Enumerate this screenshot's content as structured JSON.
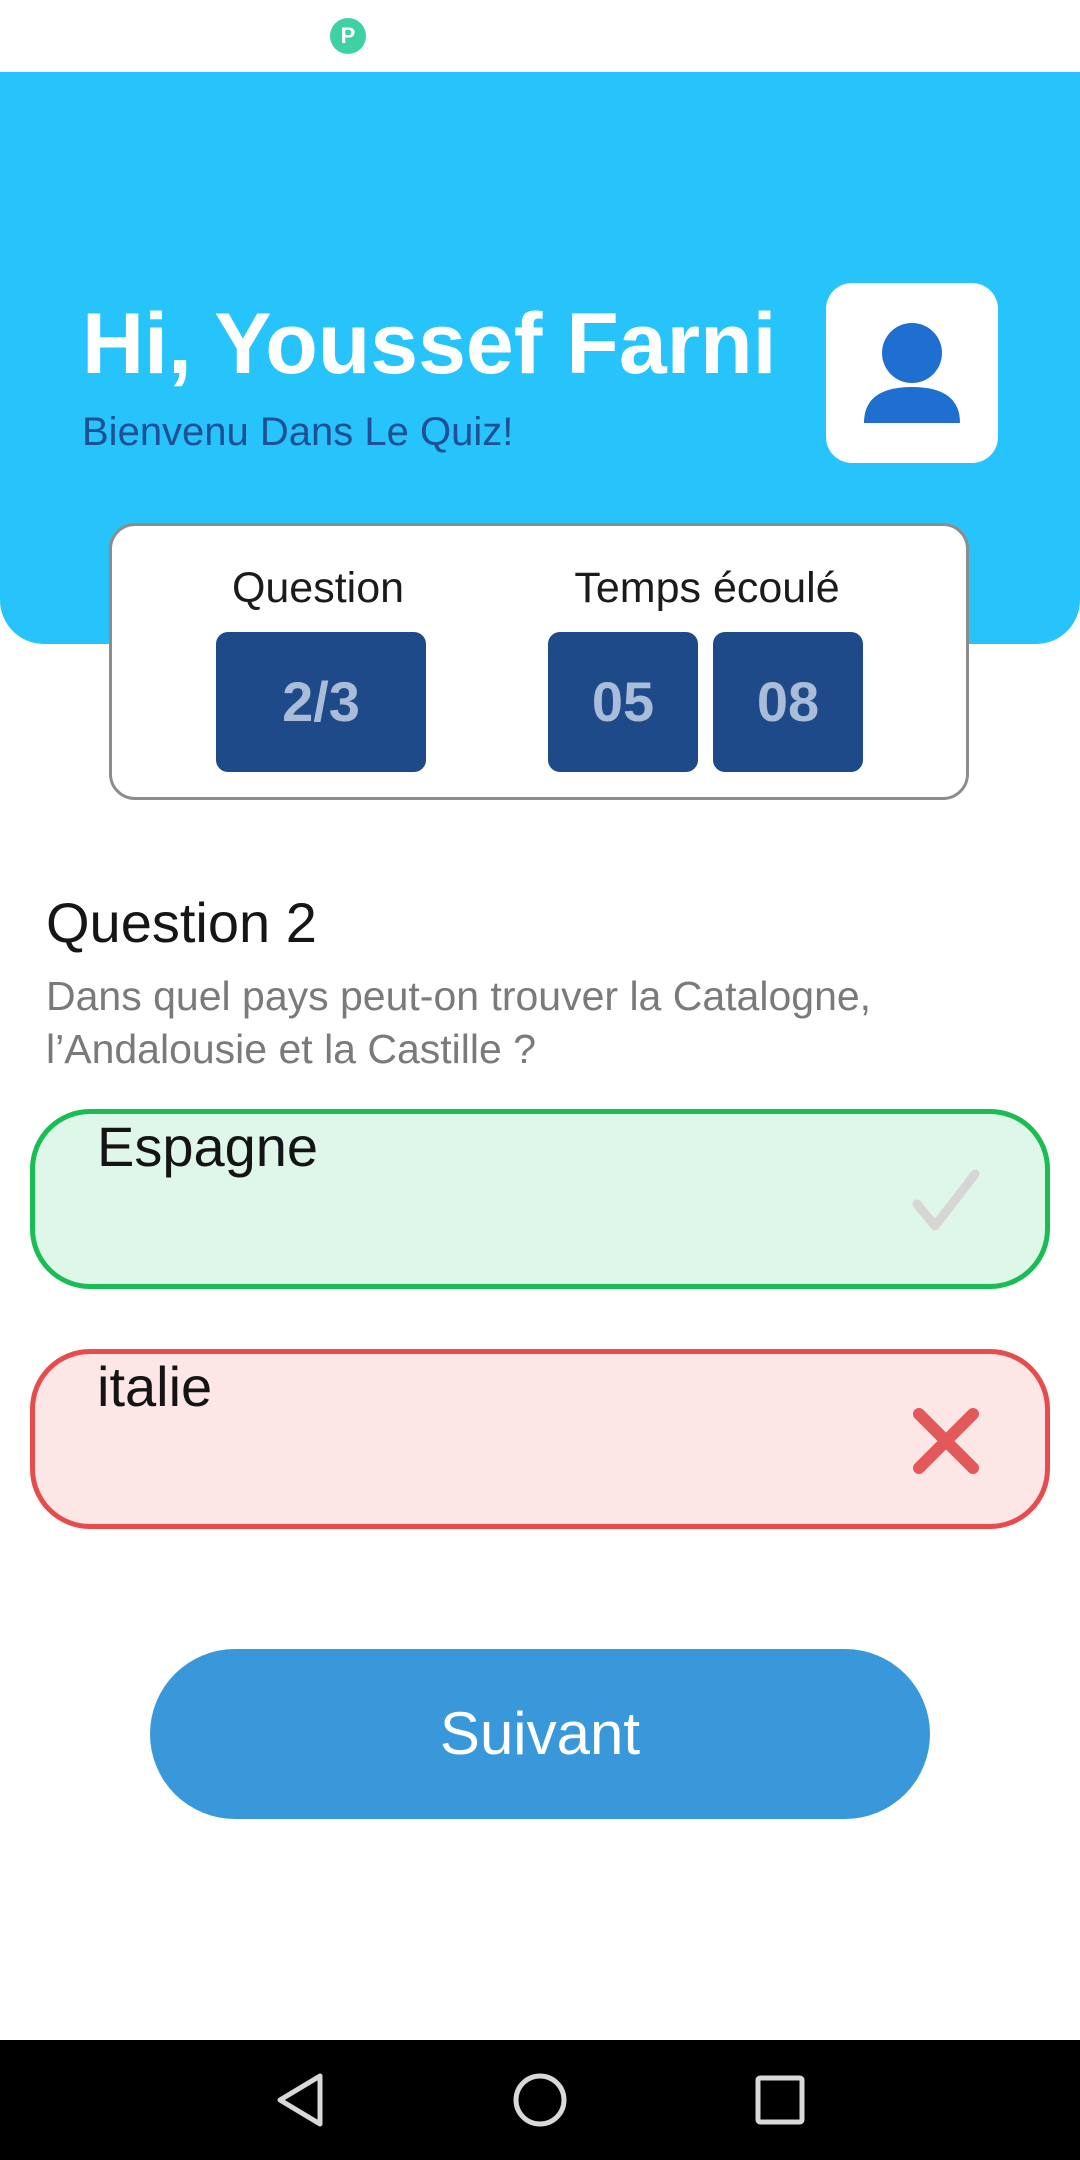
{
  "status_bar": {
    "app_icon": "parking-app-icon",
    "app_icon_glyph": "P"
  },
  "header": {
    "greeting": "Hi, Youssef Farni",
    "subtitle": "Bienvenu Dans Le Quiz!",
    "avatar_icon": "user-silhouette-icon",
    "background_color": "#27c4fb"
  },
  "stats": {
    "question_label": "Question",
    "question_progress": "2/3",
    "time_label": "Temps écoulé",
    "time_minutes": "05",
    "time_seconds": "08",
    "box_color": "#1f4a8a"
  },
  "question": {
    "title": "Question 2",
    "text": "Dans quel pays peut-on trouver la Catalogne, l’Andalousie et la Castille ?"
  },
  "answers": [
    {
      "label": "Espagne",
      "status": "correct",
      "icon": "check-icon",
      "color": "#19bd54"
    },
    {
      "label": "italie",
      "status": "wrong",
      "icon": "cross-icon",
      "color": "#e84b4b"
    }
  ],
  "next_button": {
    "label": "Suivant",
    "color": "#3898da"
  },
  "nav_bar": {
    "icons": [
      "back-icon",
      "home-icon",
      "recents-icon"
    ]
  }
}
